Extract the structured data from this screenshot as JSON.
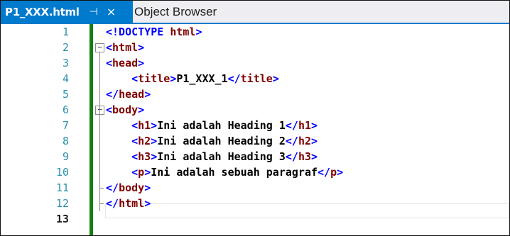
{
  "tabs": {
    "active": {
      "title": "P1_XXX.html",
      "pin_glyph": "⊣",
      "close_glyph": "×"
    },
    "inactive": {
      "title": "Object Browser"
    }
  },
  "editor": {
    "lines": [
      {
        "n": "1",
        "indent": "",
        "parts": [
          [
            "br",
            "<"
          ],
          [
            "br",
            "!DOCTYPE"
          ],
          [
            "txt",
            " "
          ],
          [
            "tag",
            "html"
          ],
          [
            "br",
            ">"
          ]
        ]
      },
      {
        "n": "2",
        "indent": "",
        "parts": [
          [
            "br",
            "<"
          ],
          [
            "tag",
            "html"
          ],
          [
            "br",
            ">"
          ]
        ]
      },
      {
        "n": "3",
        "indent": "",
        "parts": [
          [
            "br",
            "<"
          ],
          [
            "tag",
            "head"
          ],
          [
            "br",
            ">"
          ]
        ]
      },
      {
        "n": "4",
        "indent": "    ",
        "parts": [
          [
            "br",
            "<"
          ],
          [
            "tag",
            "title"
          ],
          [
            "br",
            ">"
          ],
          [
            "txt",
            "P1_XXX_1"
          ],
          [
            "br",
            "</"
          ],
          [
            "tag",
            "title"
          ],
          [
            "br",
            ">"
          ]
        ]
      },
      {
        "n": "5",
        "indent": "",
        "parts": [
          [
            "br",
            "</"
          ],
          [
            "tag",
            "head"
          ],
          [
            "br",
            ">"
          ]
        ]
      },
      {
        "n": "6",
        "indent": "",
        "parts": [
          [
            "br",
            "<"
          ],
          [
            "tag",
            "body"
          ],
          [
            "br",
            ">"
          ]
        ]
      },
      {
        "n": "7",
        "indent": "    ",
        "parts": [
          [
            "br",
            "<"
          ],
          [
            "tag",
            "h1"
          ],
          [
            "br",
            ">"
          ],
          [
            "txt",
            "Ini adalah Heading 1"
          ],
          [
            "br",
            "</"
          ],
          [
            "tag",
            "h1"
          ],
          [
            "br",
            ">"
          ]
        ]
      },
      {
        "n": "8",
        "indent": "    ",
        "parts": [
          [
            "br",
            "<"
          ],
          [
            "tag",
            "h2"
          ],
          [
            "br",
            ">"
          ],
          [
            "txt",
            "Ini adalah Heading 2"
          ],
          [
            "br",
            "</"
          ],
          [
            "tag",
            "h2"
          ],
          [
            "br",
            ">"
          ]
        ]
      },
      {
        "n": "9",
        "indent": "    ",
        "parts": [
          [
            "br",
            "<"
          ],
          [
            "tag",
            "h3"
          ],
          [
            "br",
            ">"
          ],
          [
            "txt",
            "Ini adalah Heading 3"
          ],
          [
            "br",
            "</"
          ],
          [
            "tag",
            "h3"
          ],
          [
            "br",
            ">"
          ]
        ]
      },
      {
        "n": "10",
        "indent": "    ",
        "parts": [
          [
            "br",
            "<"
          ],
          [
            "tag",
            "p"
          ],
          [
            "br",
            ">"
          ],
          [
            "txt",
            "Ini adalah sebuah paragraf"
          ],
          [
            "br",
            "</"
          ],
          [
            "tag",
            "p"
          ],
          [
            "br",
            ">"
          ]
        ]
      },
      {
        "n": "11",
        "indent": "",
        "parts": [
          [
            "br",
            "</"
          ],
          [
            "tag",
            "body"
          ],
          [
            "br",
            ">"
          ]
        ]
      },
      {
        "n": "12",
        "indent": "",
        "parts": [
          [
            "br",
            "</"
          ],
          [
            "tag",
            "html"
          ],
          [
            "br",
            ">"
          ]
        ]
      },
      {
        "n": "13",
        "indent": "",
        "parts": []
      }
    ],
    "current_line": "13",
    "colors": {
      "tag": "#800000",
      "bracket": "#0000ff",
      "text": "#000000",
      "line_number": "#2b91af",
      "change_bar": "#108010",
      "tab_accent": "#007acc"
    },
    "fold_glyph": "−"
  }
}
